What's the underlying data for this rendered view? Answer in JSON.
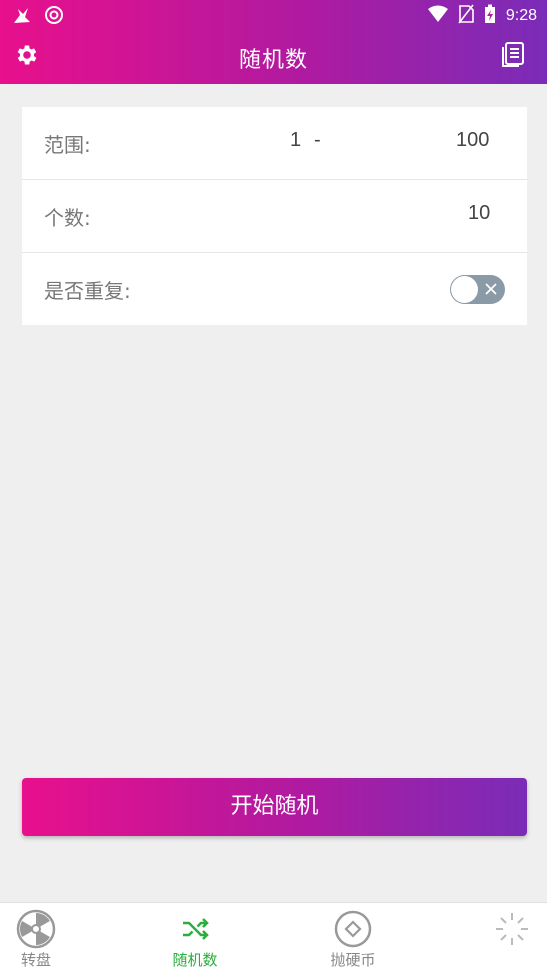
{
  "status_bar": {
    "time": "9:28",
    "icons": [
      "notification-bird-icon",
      "circle-sync-icon",
      "wifi-icon",
      "no-sim-icon",
      "battery-charging-icon"
    ]
  },
  "app_bar": {
    "title": "随机数",
    "left_icon": "gear-icon",
    "right_icon": "history-list-icon"
  },
  "settings": {
    "range": {
      "label": "范围:",
      "min": "1",
      "separator": "-",
      "max": "100"
    },
    "count": {
      "label": "个数:",
      "value": "10"
    },
    "repeat": {
      "label": "是否重复:",
      "enabled": false
    }
  },
  "start_button": {
    "label": "开始随机"
  },
  "bottom_nav": {
    "items": [
      {
        "label": "转盘",
        "icon": "wheel-icon",
        "active": false
      },
      {
        "label": "随机数",
        "icon": "shuffle-icon",
        "active": true
      },
      {
        "label": "抛硬币",
        "icon": "coin-icon",
        "active": false
      },
      {
        "label": "",
        "icon": "sparkle-icon",
        "active": false
      }
    ]
  },
  "colors": {
    "gradient_start": "#e8108c",
    "gradient_end": "#7a2cb8",
    "active_nav": "#2bae3e",
    "toggle_off": "#8a9aa6"
  }
}
